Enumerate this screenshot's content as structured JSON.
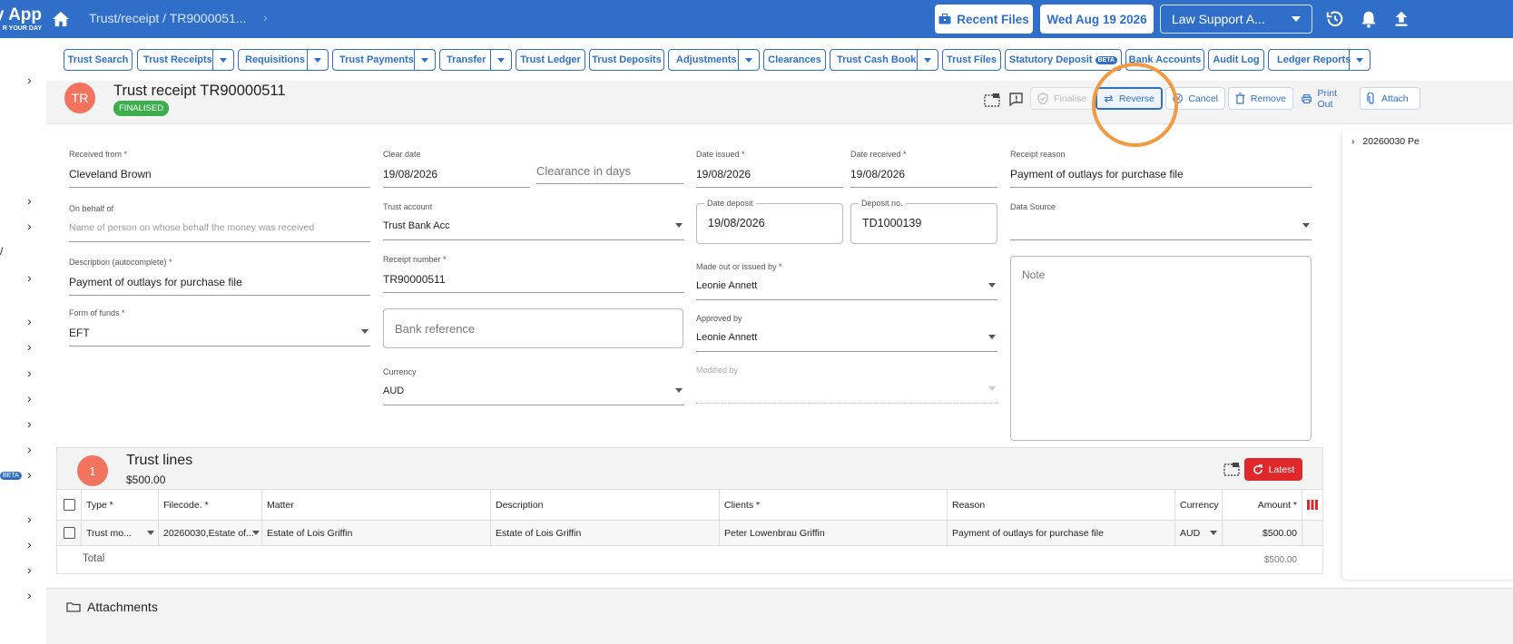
{
  "topbar": {
    "logo_top": "y App",
    "logo_bottom": "R YOUR DAY",
    "breadcrumb": "Trust/receipt / TR9000051...",
    "recent_files": "Recent Files",
    "date": "Wed Aug 19 2026",
    "firm": "Law Support A..."
  },
  "menu": {
    "items": [
      "Trust Search",
      "Trust Receipts",
      "Requisitions",
      "Trust Payments",
      "Transfer",
      "Trust Ledger",
      "Trust Deposits",
      "Adjustments",
      "Clearances",
      "Trust Cash Book",
      "Trust Files",
      "Statutory Deposit",
      "Bank Accounts",
      "Audit Log",
      "Ledger Reports"
    ],
    "beta": "BETA"
  },
  "leftrail": {
    "beta": "BETA",
    "slash": "/"
  },
  "header": {
    "avatar": "TR",
    "title": "Trust receipt TR90000511",
    "status": "FINALISED",
    "actions": {
      "finalise": "Finalise",
      "reverse": "Reverse",
      "cancel": "Cancel",
      "remove": "Remove",
      "print": "Print Out",
      "attach": "Attach"
    }
  },
  "form": {
    "received_from": {
      "label": "Received from *",
      "value": "Cleveland Brown"
    },
    "on_behalf_of": {
      "label": "On behalf of",
      "placeholder": "Name of person on whose behalf the money was received"
    },
    "description": {
      "label": "Description (autocomplete) *",
      "value": "Payment of outlays for purchase file"
    },
    "form_of_funds": {
      "label": "Form of funds *",
      "value": "EFT"
    },
    "clear_date": {
      "label": "Clear date",
      "value": "19/08/2026"
    },
    "clearance_days": {
      "placeholder": "Clearance in days"
    },
    "trust_account": {
      "label": "Trust account",
      "value": "Trust Bank Acc"
    },
    "receipt_number": {
      "label": "Receipt number *",
      "value": "TR90000511"
    },
    "bank_reference": {
      "placeholder": "Bank reference"
    },
    "currency": {
      "label": "Currency",
      "value": "AUD"
    },
    "date_issued": {
      "label": "Date issued *",
      "value": "19/08/2026"
    },
    "date_received": {
      "label": "Date received *",
      "value": "19/08/2026"
    },
    "date_deposit": {
      "label": "Date deposit",
      "value": "19/08/2026"
    },
    "deposit_no": {
      "label": "Deposit no.",
      "value": "TD1000139"
    },
    "made_out_by": {
      "label": "Made out or issued by *",
      "value": "Leonie Annett"
    },
    "approved_by": {
      "label": "Approved by",
      "value": "Leonie Annett"
    },
    "modified_by": {
      "label": "Modified by",
      "value": ""
    },
    "receipt_reason": {
      "label": "Receipt reason",
      "value": "Payment of outlays for purchase file"
    },
    "data_source": {
      "label": "Data Source",
      "value": ""
    },
    "note": {
      "placeholder": "Note"
    }
  },
  "trust_lines": {
    "count": "1",
    "title": "Trust lines",
    "amount": "$500.00",
    "latest": "Latest",
    "headers": [
      "Type *",
      "Filecode. *",
      "Matter",
      "Description",
      "Clients *",
      "Reason",
      "Currency",
      "Amount *"
    ],
    "row": {
      "type": "Trust mo...",
      "filecode": "20260030,Estate of...",
      "matter": "Estate of Lois Griffin",
      "description": "Estate of Lois Griffin",
      "clients": "Peter Lowenbrau Griffin",
      "reason": "Payment of outlays for purchase file",
      "currency": "AUD",
      "amount": "$500.00"
    },
    "total_label": "Total",
    "total_value": "$500.00"
  },
  "rightpanel": {
    "item": "20260030 Pe"
  },
  "attachments": {
    "title": "Attachments"
  }
}
